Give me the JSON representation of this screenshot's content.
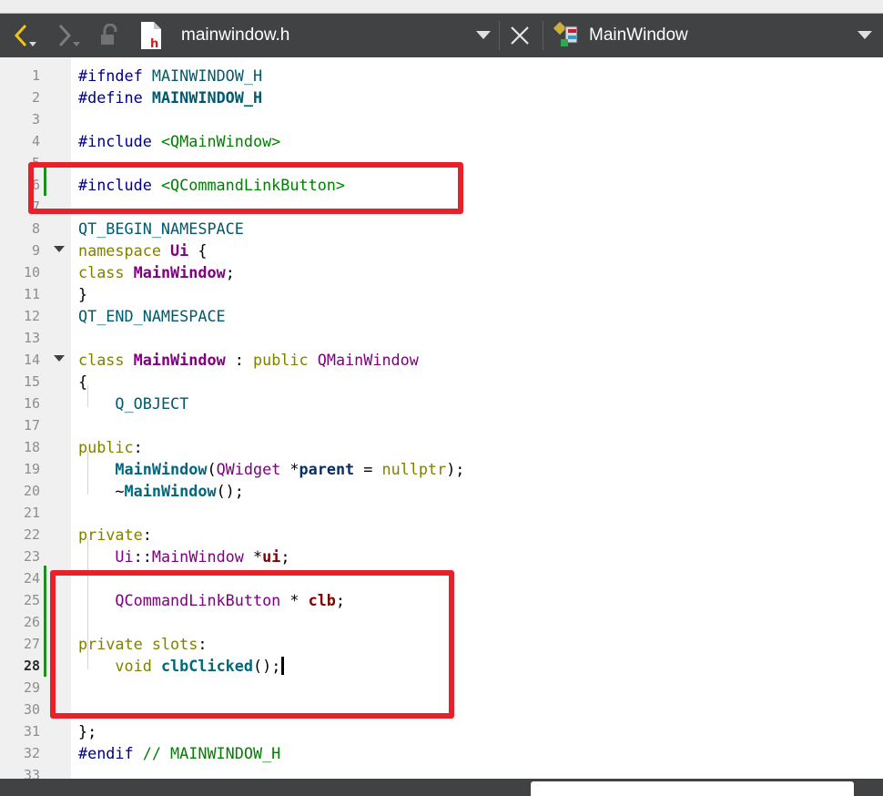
{
  "toolbar": {
    "file_name": "mainwindow.h",
    "symbol_name": "MainWindow"
  },
  "code": {
    "lines": [
      {
        "n": "1",
        "html": "<span class=\"pp\">#ifndef</span> <span class=\"mac\">MAINWINDOW_H</span>"
      },
      {
        "n": "2",
        "html": "<span class=\"pp\">#define</span> <span class=\"macb\">MAINWINDOW_H</span>"
      },
      {
        "n": "3",
        "html": ""
      },
      {
        "n": "4",
        "html": "<span class=\"pp\">#include</span> <span class=\"str\">&lt;QMainWindow&gt;</span>"
      },
      {
        "n": "5",
        "html": ""
      },
      {
        "n": "6",
        "html": "<span class=\"pp\">#include</span> <span class=\"str\">&lt;QCommandLinkButton&gt;</span>"
      },
      {
        "n": "7",
        "html": ""
      },
      {
        "n": "8",
        "html": "<span class=\"mac\">QT_BEGIN_NAMESPACE</span>"
      },
      {
        "n": "9",
        "html": "<span class=\"kw\">namespace</span> <span class=\"typb\">Ui</span> {"
      },
      {
        "n": "10",
        "html": "<span class=\"kw\">class</span> <span class=\"typb\">MainWindow</span>;"
      },
      {
        "n": "11",
        "html": "}"
      },
      {
        "n": "12",
        "html": "<span class=\"mac\">QT_END_NAMESPACE</span>"
      },
      {
        "n": "13",
        "html": ""
      },
      {
        "n": "14",
        "html": "<span class=\"kw\">class</span> <span class=\"typb\">MainWindow</span> : <span class=\"kw\">public</span> <span class=\"typ\">QMainWindow</span>"
      },
      {
        "n": "15",
        "html": "{"
      },
      {
        "n": "16",
        "html": "    <span class=\"mac\">Q_OBJECT</span>"
      },
      {
        "n": "17",
        "html": ""
      },
      {
        "n": "18",
        "html": "<span class=\"kw\">public</span>:"
      },
      {
        "n": "19",
        "html": "    <span class=\"fn\">MainWindow</span>(<span class=\"typ\">QWidget</span> *<span class=\"par\">parent</span> = <span class=\"kw\">nullptr</span>);"
      },
      {
        "n": "20",
        "html": "    ~<span class=\"fn\">MainWindow</span>();"
      },
      {
        "n": "21",
        "html": ""
      },
      {
        "n": "22",
        "html": "<span class=\"kw\">private</span>:"
      },
      {
        "n": "23",
        "html": "    <span class=\"typ\">Ui</span>::<span class=\"typ\">MainWindow</span> *<span class=\"mem\">ui</span>;"
      },
      {
        "n": "24",
        "html": ""
      },
      {
        "n": "25",
        "html": "    <span class=\"typ\">QCommandLinkButton</span> * <span class=\"mem\">clb</span>;"
      },
      {
        "n": "26",
        "html": ""
      },
      {
        "n": "27",
        "html": "<span class=\"kw\">private slots</span>:"
      },
      {
        "n": "28",
        "html": "    <span class=\"kw\">void</span> <span class=\"fn\">clbClicked</span>();<span class=\"caret\"></span>"
      },
      {
        "n": "29",
        "html": ""
      },
      {
        "n": "30",
        "html": ""
      },
      {
        "n": "31",
        "html": "};"
      },
      {
        "n": "32",
        "html": "<span class=\"pp\">#endif</span> <span class=\"cmt\">// MAINWINDOW_H</span>"
      },
      {
        "n": "33",
        "html": ""
      }
    ],
    "current_line": "28",
    "fold_lines": [
      "9",
      "14"
    ]
  }
}
